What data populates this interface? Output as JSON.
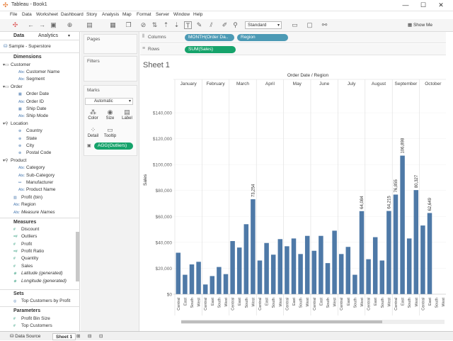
{
  "window": {
    "title": "Tableau - Book1",
    "min": "—",
    "max": "☐",
    "close": "✕"
  },
  "menu": [
    "File",
    "Data",
    "Worksheet",
    "Dashboard",
    "Story",
    "Analysis",
    "Map",
    "Format",
    "Server",
    "Window",
    "Help"
  ],
  "toolbar": {
    "fit_select": "Standard",
    "show_me": "Show Me"
  },
  "left_panel": {
    "tabs": [
      "Data",
      "Analytics"
    ],
    "datasource": "Sample - Superstore",
    "dimensions_header": "Dimensions",
    "dimensions": [
      {
        "label": "Customer",
        "kind": "group"
      },
      {
        "label": "Customer Name",
        "kind": "abc"
      },
      {
        "label": "Segment",
        "kind": "abc"
      },
      {
        "label": "Order",
        "kind": "group"
      },
      {
        "label": "Order Date",
        "kind": "date"
      },
      {
        "label": "Order ID",
        "kind": "abc"
      },
      {
        "label": "Ship Date",
        "kind": "date"
      },
      {
        "label": "Ship Mode",
        "kind": "abc"
      },
      {
        "label": "Location",
        "kind": "group"
      },
      {
        "label": "Country",
        "kind": "geo"
      },
      {
        "label": "State",
        "kind": "geo"
      },
      {
        "label": "City",
        "kind": "geo"
      },
      {
        "label": "Postal Code",
        "kind": "geo"
      },
      {
        "label": "Product",
        "kind": "group"
      },
      {
        "label": "Category",
        "kind": "abc"
      },
      {
        "label": "Sub-Category",
        "kind": "abc"
      },
      {
        "label": "Manufacturer",
        "kind": "abc"
      },
      {
        "label": "Product Name",
        "kind": "abc"
      },
      {
        "label": "Profit (bin)",
        "kind": "bin"
      },
      {
        "label": "Region",
        "kind": "abc"
      },
      {
        "label": "Measure Names",
        "kind": "abc"
      }
    ],
    "measures_header": "Measures",
    "measures": [
      "Discount",
      "Outliers",
      "Profit",
      "Profit Ratio",
      "Quantity",
      "Sales",
      "Latitude (generated)",
      "Longitude (generated)"
    ],
    "sets_header": "Sets",
    "sets": [
      "Top Customers by Profit"
    ],
    "parameters_header": "Parameters",
    "parameters": [
      "Profit Bin Size",
      "Top Customers"
    ]
  },
  "cards": {
    "pages": "Pages",
    "filters": "Filters",
    "marks": "Marks",
    "mark_type": "Automatic",
    "mark_buttons": [
      "Color",
      "Size",
      "Label",
      "Detail",
      "Tooltip"
    ],
    "mark_pill": "AGG(Outliers)"
  },
  "shelves": {
    "columns_label": "Columns",
    "columns_pills": [
      "MONTH(Order Da..",
      "Region"
    ],
    "rows_label": "Rows",
    "rows_pills": [
      "SUM(Sales)"
    ]
  },
  "sheet": {
    "title": "Sheet 1",
    "column_header": "Order Date / Region",
    "ylabel": "Sales",
    "yticks": [
      "$140,000",
      "$120,000",
      "$100,000",
      "$80,000",
      "$60,000",
      "$40,000",
      "$20,000",
      "$0"
    ]
  },
  "statusbar": {
    "data_source": "Data Source",
    "sheet": "Sheet 1"
  },
  "colors": {
    "bar": "#4e79a7",
    "pill_green": "#16a36b",
    "pill_blue": "#4c9ab5"
  },
  "chart_data": {
    "type": "bar",
    "title": "",
    "xlabel": "Order Date / Region",
    "ylabel": "Sales",
    "ylim": [
      0,
      150000
    ],
    "months": [
      "January",
      "February",
      "March",
      "April",
      "May",
      "June",
      "July",
      "August",
      "September",
      "October"
    ],
    "regions": [
      "Central",
      "East",
      "South",
      "West"
    ],
    "values": [
      [
        32000,
        15000,
        23000,
        25000
      ],
      [
        7500,
        14000,
        21000,
        15500
      ],
      [
        41000,
        36000,
        54000,
        73254
      ],
      [
        26000,
        39500,
        30500,
        42500
      ],
      [
        37000,
        43000,
        31000,
        45000
      ],
      [
        33500,
        45000,
        24000,
        49000
      ],
      [
        31000,
        36500,
        15000,
        64084
      ],
      [
        27000,
        44000,
        26000,
        64215
      ],
      [
        76855,
        106898,
        43000,
        80327
      ],
      [
        53000,
        62649,
        null,
        null
      ]
    ],
    "data_labels": {
      "March-West": "73,254",
      "July-West": "64,084",
      "August-West": "64,215",
      "September-Central": "76,855",
      "September-East": "106,898",
      "September-West": "80,327",
      "October-East": "62,649"
    }
  }
}
